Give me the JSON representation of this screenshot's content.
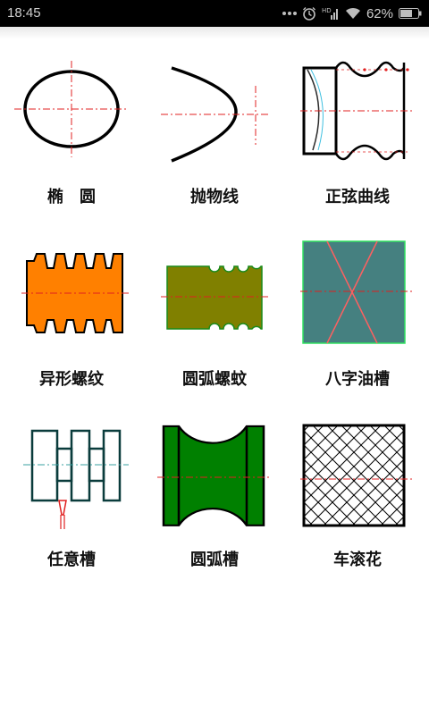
{
  "status_bar": {
    "time": "18:45",
    "battery": "62%",
    "icons": [
      "dots-icon",
      "alarm-icon",
      "hd-signal-icon",
      "wifi-icon",
      "battery-icon"
    ]
  },
  "grid": {
    "items": [
      {
        "label": "椭　圆",
        "icon": "ellipse-icon"
      },
      {
        "label": "抛物线",
        "icon": "parabola-icon"
      },
      {
        "label": "正弦曲线",
        "icon": "sine-curve-icon"
      },
      {
        "label": "异形螺纹",
        "icon": "irregular-thread-icon"
      },
      {
        "label": "圆弧螺蚊",
        "icon": "arc-thread-icon"
      },
      {
        "label": "八字油槽",
        "icon": "figure-eight-oil-groove-icon"
      },
      {
        "label": "任意槽",
        "icon": "arbitrary-groove-icon"
      },
      {
        "label": "圆弧槽",
        "icon": "arc-groove-icon"
      },
      {
        "label": "车滚花",
        "icon": "knurling-icon"
      }
    ]
  },
  "colors": {
    "orange_fill": "#ff8000",
    "olive_fill": "#808000",
    "teal_fill": "#458080",
    "green_fill": "#008000",
    "dark_teal_stroke": "#0a3c3c",
    "centerline_red": "#e02020"
  }
}
